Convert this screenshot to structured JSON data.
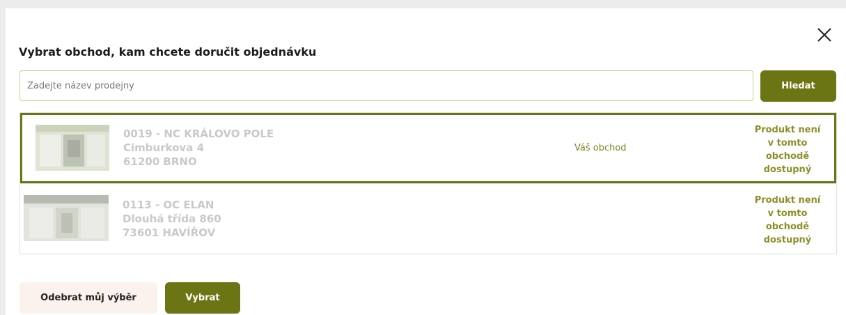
{
  "dialog": {
    "title": "Vybrat obchod, kam chcete doručit objednávku",
    "close_icon": "close-icon"
  },
  "search": {
    "placeholder": "Zadejte název prodejny",
    "value": "",
    "button_label": "Hledat"
  },
  "stores": [
    {
      "name": "0019 - NC KRÁLOVO POLE",
      "street": "Cimburkova 4",
      "city": "61200 BRNO",
      "tag": "Váš obchod",
      "availability": [
        "Produkt není",
        "v tomto",
        "obchodě",
        "dostupný"
      ],
      "selected": true
    },
    {
      "name": "0113 - OC ELAN",
      "street": "Dlouhá třída 860",
      "city": "73601 HAVÍŘOV",
      "availability": [
        "Produkt není",
        "v tomto",
        "obchodě",
        "dostupný"
      ],
      "selected": false
    }
  ],
  "footer": {
    "remove_label": "Odebrat můj výběr",
    "choose_label": "Vybrat"
  },
  "colors": {
    "accent": "#6b7513",
    "availability_text": "#8a9128",
    "remove_bg": "#fbf2ed"
  }
}
